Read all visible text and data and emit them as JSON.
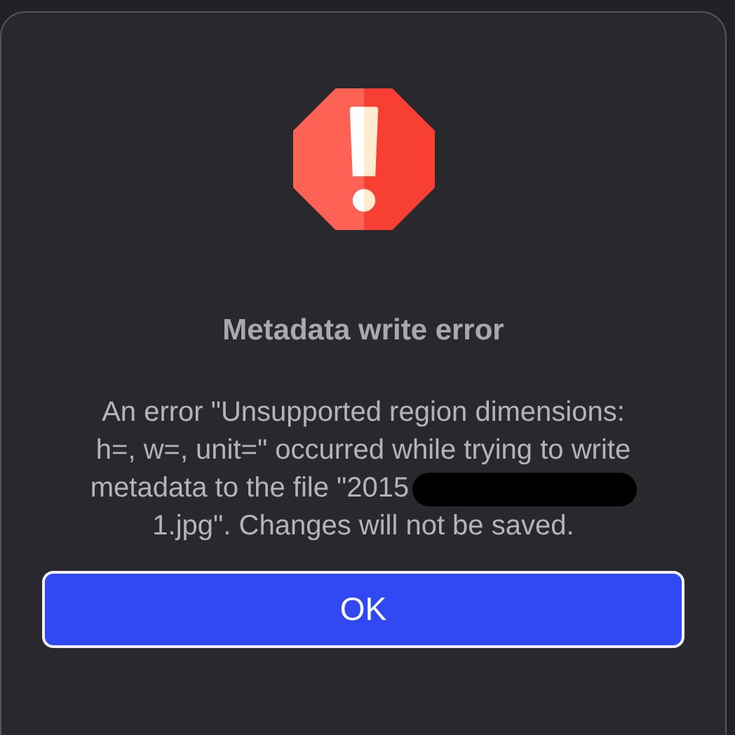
{
  "dialog": {
    "title": "Metadata write error",
    "message_lines": [
      {
        "text": "An error \"Unsupported region dimensions:",
        "redacted_after": false
      },
      {
        "text": "h=, w=, unit=\" occurred while trying to write",
        "redacted_after": false
      },
      {
        "text": "metadata to the file \"2015",
        "redacted_after": true
      },
      {
        "text": "1.jpg\". Changes will not be saved.",
        "redacted_after": false
      }
    ],
    "buttons": [
      {
        "label": "OK"
      }
    ]
  }
}
